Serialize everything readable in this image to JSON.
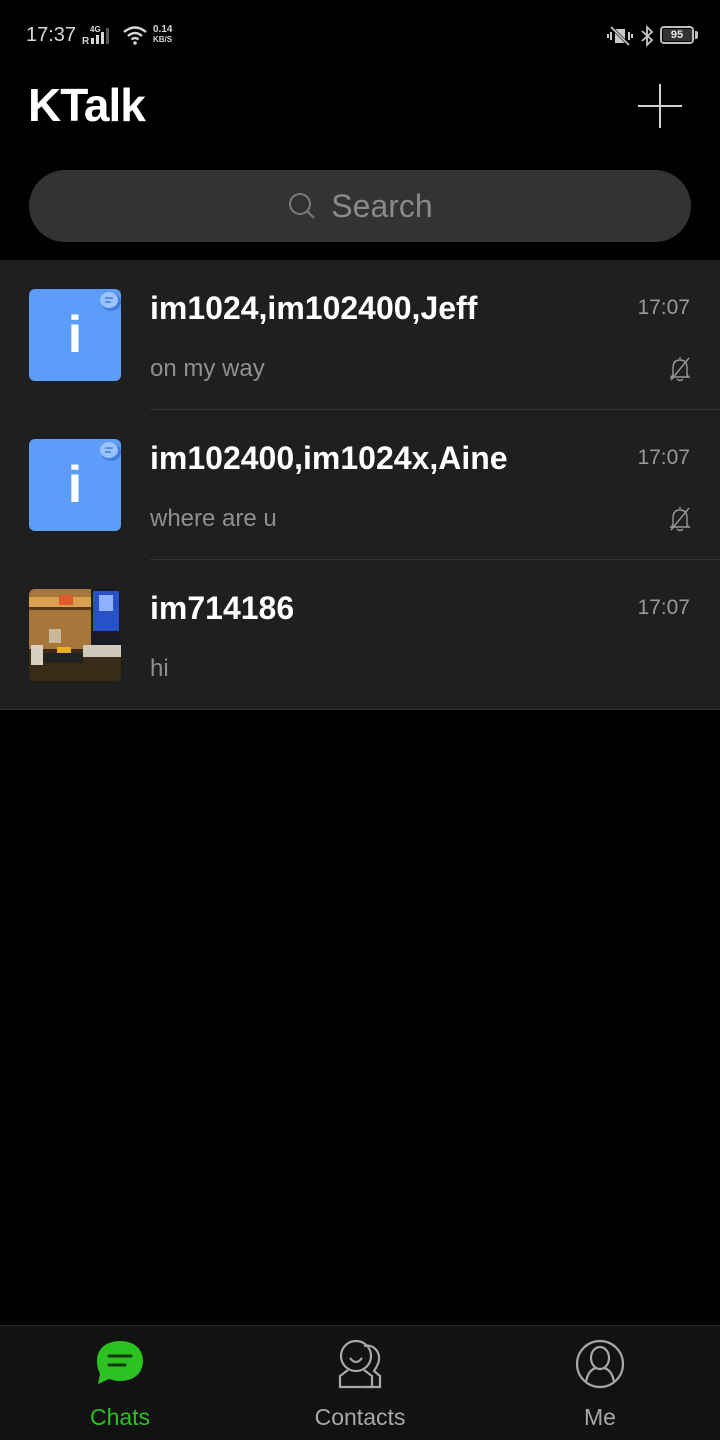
{
  "status_bar": {
    "time": "17:37",
    "network_type": "4G",
    "roaming": "R",
    "speed_value": "0.14",
    "speed_unit": "KB/S",
    "battery": "95",
    "battery_level_percent": 95
  },
  "header": {
    "title": "KTalk",
    "add_icon": "plus-icon"
  },
  "search": {
    "placeholder": "Search",
    "icon": "search-icon"
  },
  "chats": [
    {
      "name": "im1024,im102400,Jeff",
      "preview": "on my way",
      "time": "17:07",
      "avatar_type": "group-info",
      "avatar_glyph": "i",
      "muted": true
    },
    {
      "name": "im102400,im1024x,Aine",
      "preview": "where are u",
      "time": "17:07",
      "avatar_type": "group-info",
      "avatar_glyph": "i",
      "muted": true
    },
    {
      "name": "im714186",
      "preview": "hi",
      "time": "17:07",
      "avatar_type": "photo",
      "muted": false
    }
  ],
  "bottom_nav": {
    "items": [
      {
        "label": "Chats",
        "icon": "chat-bubble-icon",
        "active": true
      },
      {
        "label": "Contacts",
        "icon": "contacts-icon",
        "active": false
      },
      {
        "label": "Me",
        "icon": "profile-icon",
        "active": false
      }
    ]
  },
  "colors": {
    "accent": "#2cc21f",
    "avatar_blue": "#5c9dfa",
    "background": "#000000",
    "list_background": "#1f1f1f",
    "search_background": "#333333"
  }
}
